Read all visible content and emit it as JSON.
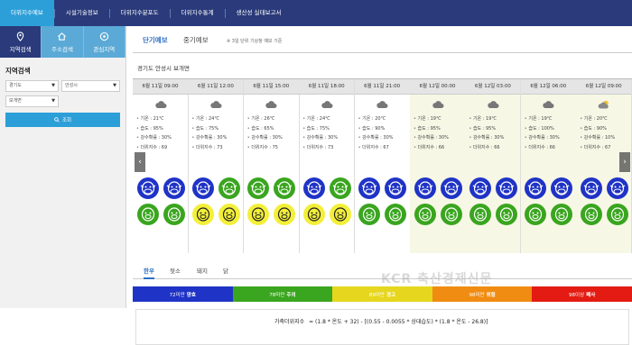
{
  "top_nav": [
    "더위지수예보",
    "시설기술정보",
    "더위지수분포도",
    "더위지수통계",
    "생산성 실태보고서"
  ],
  "left_tabs": [
    "지역검색",
    "주소검색",
    "관심지역"
  ],
  "left_panel": {
    "title": "지역검색",
    "province": "경기도",
    "city": "안성시",
    "town": "보개면",
    "search_label": "조회"
  },
  "forecast_tabs": [
    "단기예보",
    "중기예보"
  ],
  "forecast_note": "※ 3일 단위 기상청 예보 기준",
  "location": "경기도 안성시 보개면",
  "columns": [
    {
      "time": "6월 11일 09:00",
      "weather": "cloud",
      "temp": "기온 : 21℃",
      "hum": "습도 : 95%",
      "rain": "강수확률 : 30%",
      "thi": "더위지수 : 69",
      "alt": false,
      "faces": [
        "b",
        "b",
        "g",
        "g"
      ]
    },
    {
      "time": "6월 11일 12:00",
      "weather": "cloud",
      "temp": "기온 : 24℃",
      "hum": "습도 : 75%",
      "rain": "강수확률 : 30%",
      "thi": "더위지수 : 73",
      "alt": false,
      "faces": [
        "b",
        "g",
        "y",
        "y"
      ]
    },
    {
      "time": "6월 11일 15:00",
      "weather": "cloud",
      "temp": "기온 : 26℃",
      "hum": "습도 : 65%",
      "rain": "강수확률 : 30%",
      "thi": "더위지수 : 75",
      "alt": false,
      "faces": [
        "g",
        "g",
        "y",
        "y"
      ]
    },
    {
      "time": "6월 11일 18:00",
      "weather": "cloud",
      "temp": "기온 : 24℃",
      "hum": "습도 : 75%",
      "rain": "강수확률 : 30%",
      "thi": "더위지수 : 73",
      "alt": false,
      "faces": [
        "b",
        "g",
        "y",
        "y"
      ]
    },
    {
      "time": "6월 11일 21:00",
      "weather": "cloud",
      "temp": "기온 : 20℃",
      "hum": "습도 : 90%",
      "rain": "강수확률 : 30%",
      "thi": "더위지수 : 67",
      "alt": false,
      "faces": [
        "b",
        "b",
        "g",
        "g"
      ]
    },
    {
      "time": "6월 12일 00:00",
      "weather": "cloud",
      "temp": "기온 : 19℃",
      "hum": "습도 : 95%",
      "rain": "강수확률 : 30%",
      "thi": "더위지수 : 66",
      "alt": true,
      "faces": [
        "b",
        "b",
        "g",
        "g"
      ]
    },
    {
      "time": "6월 12일 03:00",
      "weather": "cloud",
      "temp": "기온 : 19℃",
      "hum": "습도 : 95%",
      "rain": "강수확률 : 30%",
      "thi": "더위지수 : 66",
      "alt": true,
      "faces": [
        "b",
        "b",
        "g",
        "g"
      ]
    },
    {
      "time": "6월 12일 06:00",
      "weather": "cloud",
      "temp": "기온 : 19℃",
      "hum": "습도 : 100%",
      "rain": "강수확률 : 30%",
      "thi": "더위지수 : 66",
      "alt": true,
      "faces": [
        "b",
        "b",
        "g",
        "g"
      ]
    },
    {
      "time": "6월 12일 09:00",
      "weather": "partly",
      "temp": "기온 : 20℃",
      "hum": "습도 : 90%",
      "rain": "강수확률 : 10%",
      "thi": "더위지수 : 67",
      "alt": true,
      "faces": [
        "b",
        "b",
        "g",
        "g"
      ]
    }
  ],
  "animal_tabs": [
    "한우",
    "젖소",
    "돼지",
    "닭"
  ],
  "legend": [
    {
      "range": "72미만",
      "level": "양호",
      "color": "#1f33c6"
    },
    {
      "range": "78미만",
      "level": "주의",
      "color": "#3aa51f"
    },
    {
      "range": "89미만",
      "level": "경고",
      "color": "#e6d61e"
    },
    {
      "range": "98미만",
      "level": "위험",
      "color": "#f08c12"
    },
    {
      "range": "98이상",
      "level": "폐사",
      "color": "#e31b12"
    }
  ],
  "formula_label": "가축더위지수",
  "formula": "= (1.8 * 온도 + 32) - [(0.55 - 0.0055 * 상대습도) * (1.8 * 온도 - 26.8)]",
  "watermark": "KCR 축산경제신문",
  "colors": {
    "face_blue": "#1f33c6",
    "face_green": "#3aa51f",
    "face_yellow": "#f3ef3a"
  }
}
